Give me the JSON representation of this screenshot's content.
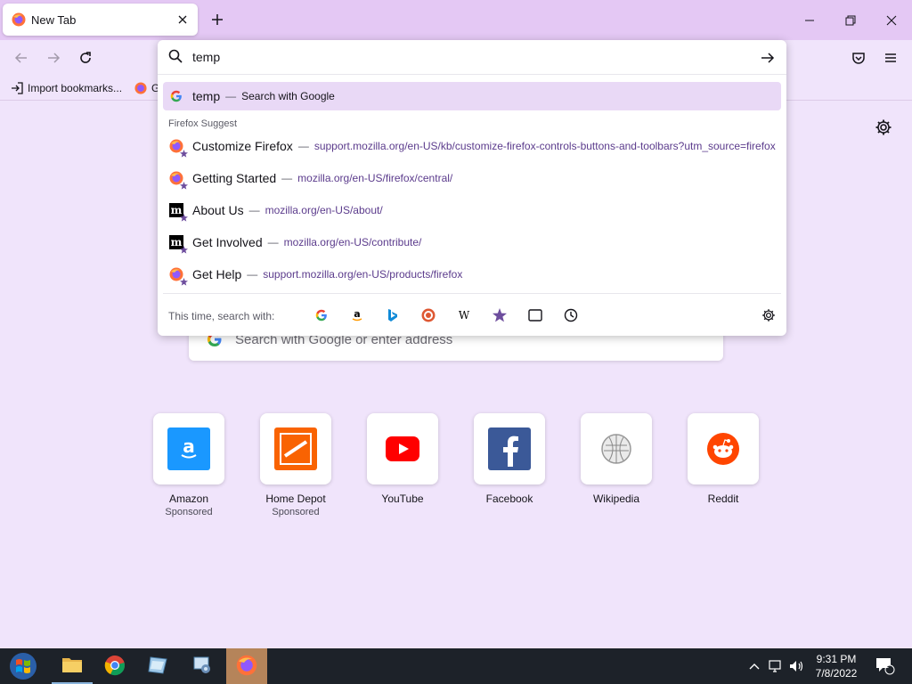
{
  "browser": {
    "tab": {
      "title": "New Tab"
    },
    "bookmarks": {
      "import_label": "Import bookmarks...",
      "second_label": "G"
    }
  },
  "urlbar": {
    "query": "temp",
    "top_result": {
      "title": "temp",
      "action": "Search with Google"
    },
    "group_label": "Firefox Suggest",
    "suggestions": [
      {
        "title": "Customize Firefox",
        "url": "support.mozilla.org/en-US/kb/customize-firefox-controls-buttons-and-toolbars?utm_source=firefox",
        "icon": "firefox-icon"
      },
      {
        "title": "Getting Started",
        "url": "mozilla.org/en-US/firefox/central/",
        "icon": "firefox-icon"
      },
      {
        "title": "About Us",
        "url": "mozilla.org/en-US/about/",
        "icon": "mozilla-icon"
      },
      {
        "title": "Get Involved",
        "url": "mozilla.org/en-US/contribute/",
        "icon": "mozilla-icon"
      },
      {
        "title": "Get Help",
        "url": "support.mozilla.org/en-US/products/firefox",
        "icon": "firefox-icon"
      }
    ],
    "separator": "—",
    "oneoff_label": "This time, search with:",
    "oneoff_engines": [
      "google-icon",
      "amazon-icon",
      "bing-icon",
      "duckduckgo-icon",
      "wikipedia-icon",
      "bookmarks-icon",
      "tabs-icon",
      "history-icon"
    ]
  },
  "newtab": {
    "search_placeholder": "Search with Google or enter address",
    "tiles": [
      {
        "label": "Amazon",
        "sponsor": "Sponsored",
        "color": "#1a98ff"
      },
      {
        "label": "Home Depot",
        "sponsor": "Sponsored",
        "color": "#f96302"
      },
      {
        "label": "YouTube",
        "sponsor": "",
        "color": "#ff0000"
      },
      {
        "label": "Facebook",
        "sponsor": "",
        "color": "#3b5998"
      },
      {
        "label": "Wikipedia",
        "sponsor": "",
        "color": "#888888"
      },
      {
        "label": "Reddit",
        "sponsor": "",
        "color": "#ff4500"
      }
    ]
  },
  "taskbar": {
    "time": "9:31 PM",
    "date": "7/8/2022",
    "notification_count": "1"
  },
  "colors": {
    "accent": "#e4c8f4",
    "selected_row": "#e9d9f6",
    "url_text": "#5b3b8c"
  }
}
